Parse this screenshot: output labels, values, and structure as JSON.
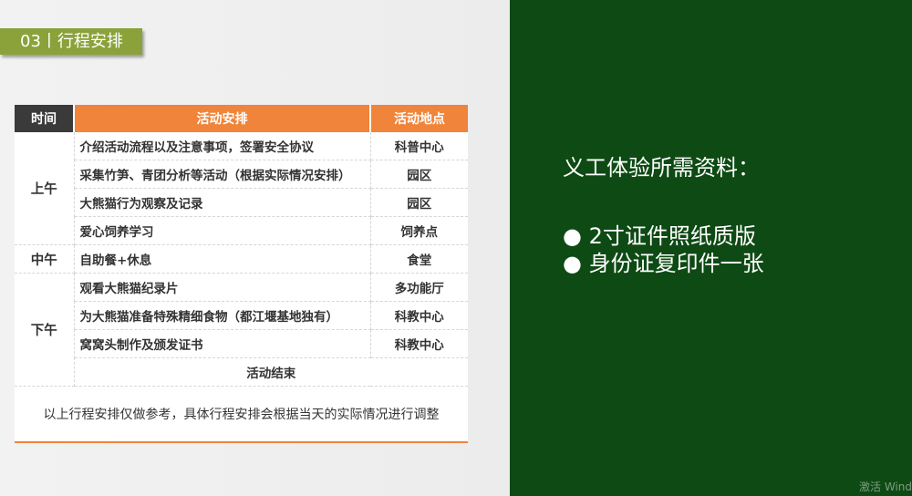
{
  "section_tag": "03丨行程安排",
  "table": {
    "headers": [
      "时间",
      "活动安排",
      "活动地点"
    ],
    "groups": [
      {
        "period": "上午",
        "rows": [
          {
            "activity": "介绍活动流程以及注意事项，签署安全协议",
            "location": "科普中心"
          },
          {
            "activity": "采集竹笋、青团分析等活动（根据实际情况安排）",
            "location": "园区"
          },
          {
            "activity": "大熊猫行为观察及记录",
            "location": "园区"
          },
          {
            "activity": "爱心饲养学习",
            "location": "饲养点"
          }
        ]
      },
      {
        "period": "中午",
        "rows": [
          {
            "activity": "自助餐+休息",
            "location": "食堂"
          }
        ]
      },
      {
        "period": "下午",
        "rows": [
          {
            "activity": "观看大熊猫纪录片",
            "location": "多功能厅"
          },
          {
            "activity": "为大熊猫准备特殊精细食物（都江堰基地独有）",
            "location": "科教中心"
          },
          {
            "activity": "窝窝头制作及颁发证书",
            "location": "科教中心"
          }
        ]
      }
    ],
    "end_label": "活动结束",
    "note": "以上行程安排仅做参考，具体行程安排会根据当天的实际情况进行调整"
  },
  "materials": {
    "title": "义工体验所需资料：",
    "items": [
      "● 2寸证件照纸质版",
      "● 身份证复印件一张"
    ]
  },
  "watermark": "激活 Wind",
  "colors": {
    "accent_orange": "#f0843a",
    "tag_green": "#8ba23a",
    "panel_green": "#0e4a14",
    "header_dark": "#3a3a3a"
  }
}
